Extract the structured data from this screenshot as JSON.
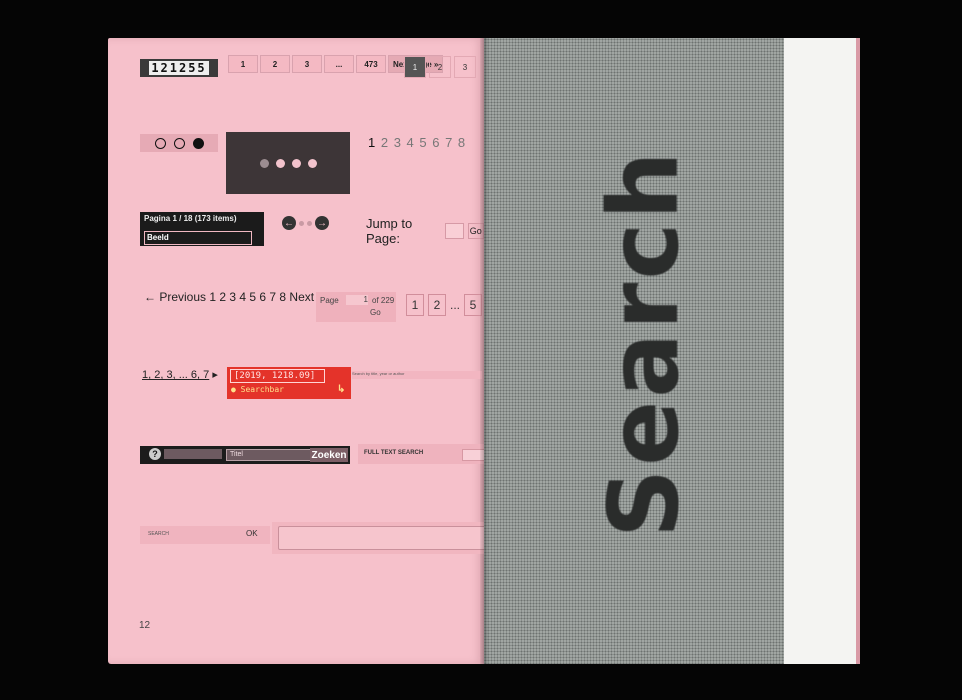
{
  "left_page": {
    "odometer": "121255",
    "pager_a": {
      "items": [
        "1",
        "2",
        "3",
        "...",
        "473"
      ],
      "next": "Next Page »"
    },
    "pager_b": {
      "items": [
        "1",
        "2",
        "3"
      ]
    },
    "number_row": {
      "first": "1",
      "rest": "2 3 4 5 6 7 8"
    },
    "pagina": {
      "line1": "Pagina 1 / 18 (173 items)",
      "line2": "Beeld"
    },
    "jump": {
      "label": "Jump to Page:",
      "go": "Go"
    },
    "prev_next": "← Previous 1 2 3 4 5 6 7 8 Next →",
    "page_box": {
      "label": "Page",
      "value": "1",
      "of": "of 229",
      "go": "Go"
    },
    "pager_c": {
      "items": [
        "1",
        "2"
      ],
      "ellipsis": "...",
      "last": "5"
    },
    "underlined_nums": "1, 2, 3, ... 6, 7",
    "red_box": {
      "code": "[2019, 1218.09]",
      "searchbar": "● Searchbar",
      "arrow": "↳"
    },
    "small_search": "Search by title, year or author",
    "black_bar": {
      "q": "?",
      "select": "Titel",
      "button": "Zoeken"
    },
    "fulltext": "FULL TEXT SEARCH",
    "search_ok": {
      "label": "SEARCH",
      "ok": "OK"
    },
    "page_number": "12"
  },
  "right_page": {
    "word": "Search"
  },
  "colors": {
    "pink_paper": "#f6c1cb",
    "grey_halftone": "#a3a8a5",
    "red_widget": "#e4332a",
    "background": "#050505"
  }
}
